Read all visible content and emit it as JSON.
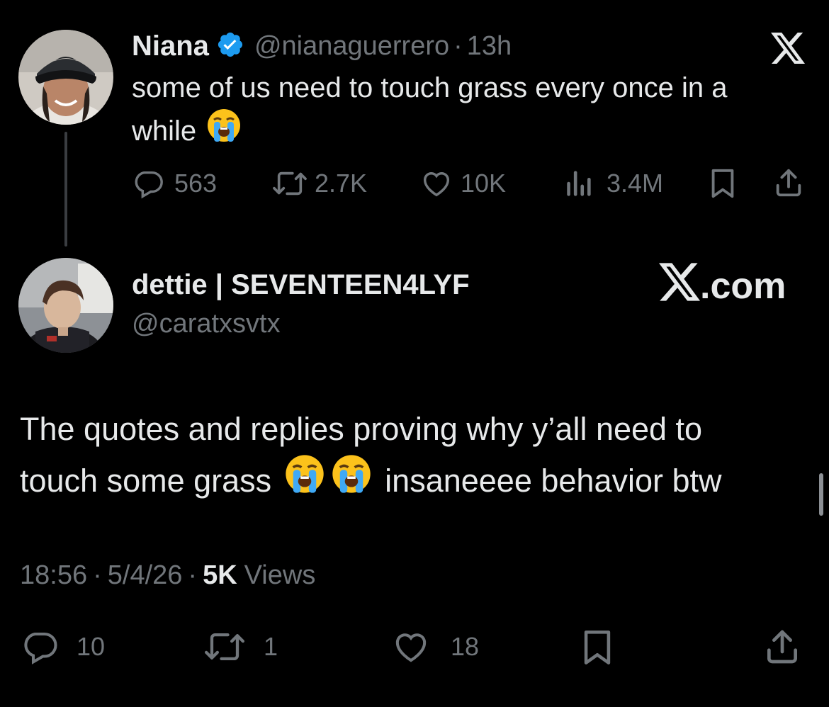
{
  "parent_tweet": {
    "display_name": "Niana",
    "verified": true,
    "handle": "@nianaguerrero",
    "separator": "·",
    "time_ago": "13h",
    "text_line1": "some of us need to touch grass every once in a",
    "text_line2": "while",
    "emoji": "loudly-crying-face",
    "replies": "563",
    "reposts": "2.7K",
    "likes": "10K",
    "views": "3.4M"
  },
  "quote_tweet": {
    "display_name": "dettie | SEVENTEEN4LYF",
    "handle": "@caratxsvtx",
    "source_label": ".com",
    "text_line1": "The quotes and replies proving why y’all need to",
    "text_line2_a": "touch some grass",
    "text_line2_b": "insaneeee behavior btw",
    "time": "18:56",
    "date": "5/4/26",
    "views_count": "5K",
    "views_label": "Views",
    "separator": "·",
    "replies": "10",
    "reposts": "1",
    "likes": "18"
  },
  "colors": {
    "background": "#000000",
    "text": "#e7e9ea",
    "muted": "#71767b",
    "verified": "#1d9bf0"
  }
}
